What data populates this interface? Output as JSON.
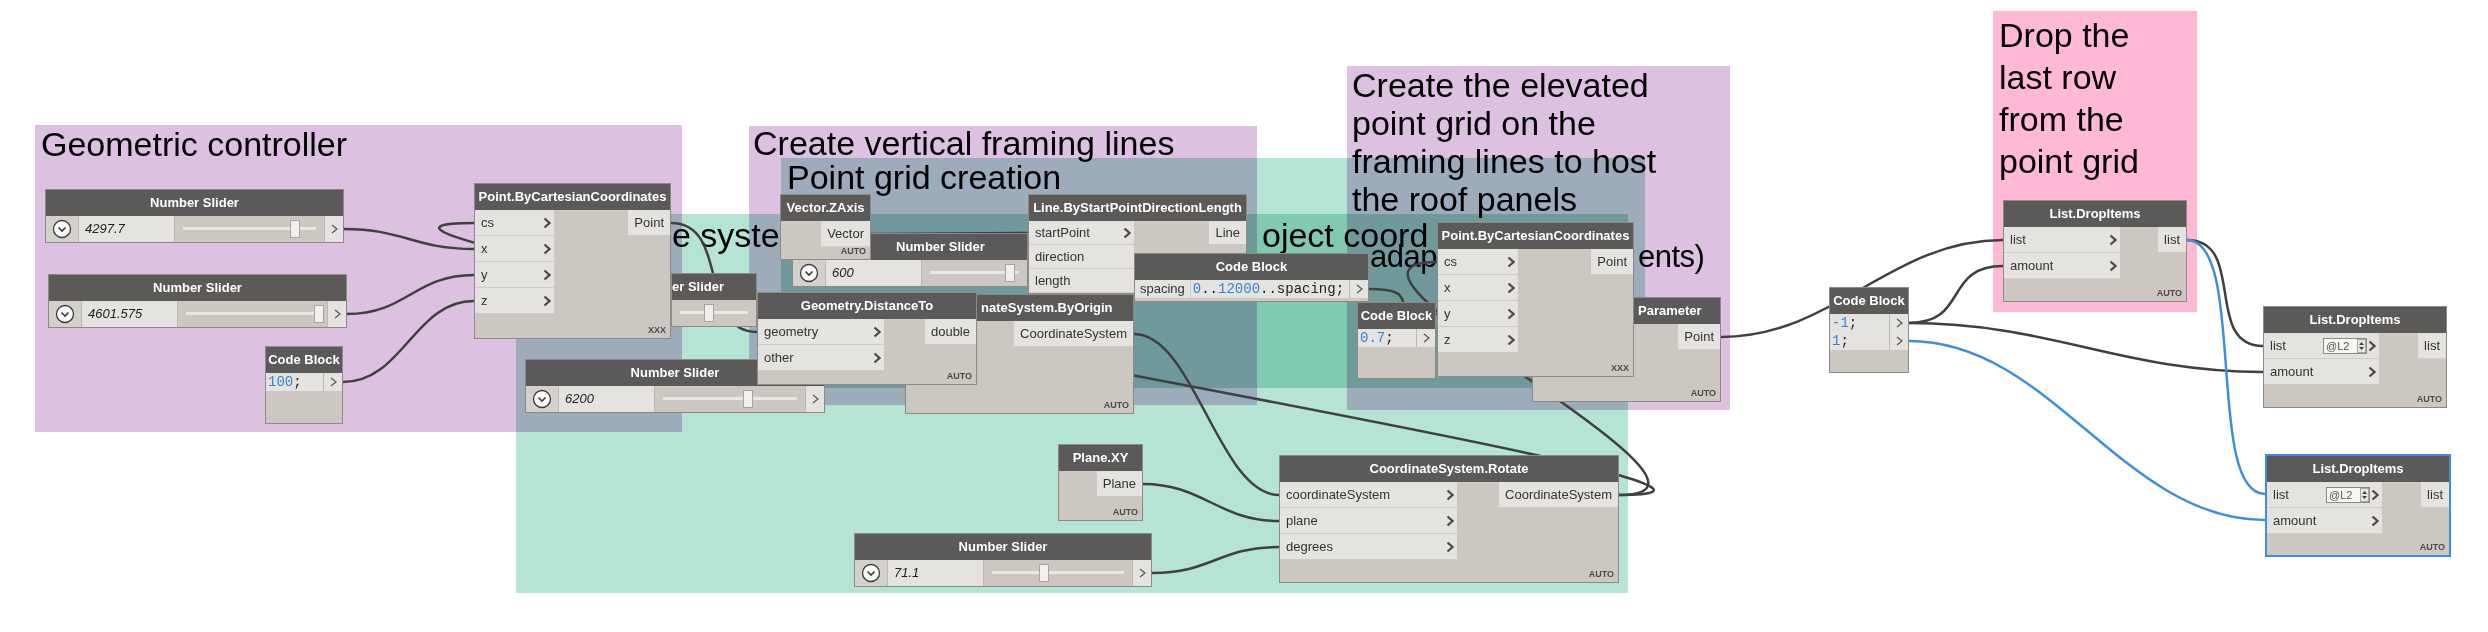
{
  "workspace": {
    "groups": [
      {
        "title": "Geometric controller",
        "color": "#dcc1e1"
      },
      {
        "title": "Create vertical framing lines",
        "color": "#dcc1e1"
      },
      {
        "title": "Point grid creation",
        "color": "#b5e3d4"
      },
      {
        "title": "Create the elevated point grid on the framing lines to host the roof panels",
        "title_fragments": [
          "adap",
          "ents)"
        ],
        "color": "#dcc1e1"
      },
      {
        "title_fragments": [
          "e syste",
          "oject coord"
        ],
        "color": "#b5e3d4"
      },
      {
        "title": "Drop the last row from the point grid",
        "color": "#ffb9d6"
      }
    ],
    "nodes": [
      {
        "kind": "slider",
        "title": "Number Slider",
        "value": "4297.7",
        "level": 0.83,
        "selected": false
      },
      {
        "kind": "slider",
        "title": "Number Slider",
        "value": "4601.575",
        "level": 0.98,
        "selected": false
      },
      {
        "kind": "code",
        "title": "Code Block",
        "lines": [
          {
            "code": "100;"
          }
        ],
        "selected": false
      },
      {
        "kind": "function",
        "title": "Point.ByCartesianCoordinates",
        "inputs": [
          {
            "label": "cs"
          },
          {
            "label": "x"
          },
          {
            "label": "y"
          },
          {
            "label": "z"
          }
        ],
        "outputs": [
          "Point"
        ],
        "lacing": "XXX",
        "selected": false
      },
      {
        "kind": "function",
        "title": "Vector.ZAxis",
        "outputs": [
          "Vector"
        ],
        "lacing": "AUTO",
        "selected": false
      },
      {
        "kind": "slider",
        "title": "er Slider",
        "level": 0.43,
        "selected": false
      },
      {
        "kind": "slider",
        "title": "Number Slider",
        "value": "600",
        "level": 0.87,
        "selected": false
      },
      {
        "kind": "function",
        "title": "Geometry.DistanceTo",
        "inputs": [
          {
            "label": "geometry"
          },
          {
            "label": "other"
          }
        ],
        "outputs": [
          "double"
        ],
        "lacing": "AUTO",
        "selected": false
      },
      {
        "kind": "function",
        "title": "Line.ByStartPointDirectionLength",
        "inputs": [
          {
            "label": "startPoint"
          },
          {
            "label": "direction"
          },
          {
            "label": "length"
          }
        ],
        "outputs": [
          "Line"
        ],
        "selected": false
      },
      {
        "kind": "slider",
        "title": "Number Slider",
        "value": "6200",
        "level": 0.63,
        "selected": false
      },
      {
        "kind": "function",
        "title": "nateSystem.ByOrigin",
        "outputs": [
          "CoordinateSystem"
        ],
        "lacing": "AUTO",
        "selected": false
      },
      {
        "kind": "code",
        "title": "Code Block",
        "lines": [
          {
            "input": "spacing",
            "code": "0..12000..spacing;"
          }
        ],
        "selected": false
      },
      {
        "kind": "code",
        "title": "Code Block",
        "lines": [
          {
            "code": "0.7;"
          }
        ],
        "selected": false
      },
      {
        "kind": "function",
        "title": "Point.ByCartesianCoordinates",
        "inputs": [
          {
            "label": "cs"
          },
          {
            "label": "x"
          },
          {
            "label": "y"
          },
          {
            "label": "z"
          }
        ],
        "outputs": [
          "Point"
        ],
        "lacing": "XXX",
        "selected": false
      },
      {
        "kind": "function",
        "title": "Parameter",
        "outputs": [
          "Point"
        ],
        "lacing": "AUTO",
        "selected": false
      },
      {
        "kind": "code",
        "title": "Code Block",
        "lines": [
          {
            "code": "-1;"
          },
          {
            "code": "1;"
          }
        ],
        "selected": false
      },
      {
        "kind": "function",
        "title": "List.DropItems",
        "inputs": [
          {
            "label": "list"
          },
          {
            "label": "amount"
          }
        ],
        "outputs": [
          "list"
        ],
        "lacing": "AUTO",
        "selected": false
      },
      {
        "kind": "function",
        "title": "List.DropItems",
        "inputs": [
          {
            "label": "list",
            "use_level": "@L2"
          },
          {
            "label": "amount"
          }
        ],
        "outputs": [
          "list"
        ],
        "lacing": "AUTO",
        "selected": false
      },
      {
        "kind": "function",
        "title": "Plane.XY",
        "outputs": [
          "Plane"
        ],
        "lacing": "AUTO",
        "selected": false
      },
      {
        "kind": "slider",
        "title": "Number Slider",
        "value": "71.1",
        "level": 0.4,
        "selected": false
      },
      {
        "kind": "function",
        "title": "CoordinateSystem.Rotate",
        "inputs": [
          {
            "label": "coordinateSystem"
          },
          {
            "label": "plane"
          },
          {
            "label": "degrees"
          }
        ],
        "outputs": [
          "CoordinateSystem"
        ],
        "lacing": "AUTO",
        "selected": false
      },
      {
        "kind": "function",
        "title": "List.DropItems",
        "inputs": [
          {
            "label": "list",
            "use_level": "@L2"
          },
          {
            "label": "amount"
          }
        ],
        "outputs": [
          "list"
        ],
        "lacing": "AUTO",
        "selected": true
      }
    ]
  }
}
